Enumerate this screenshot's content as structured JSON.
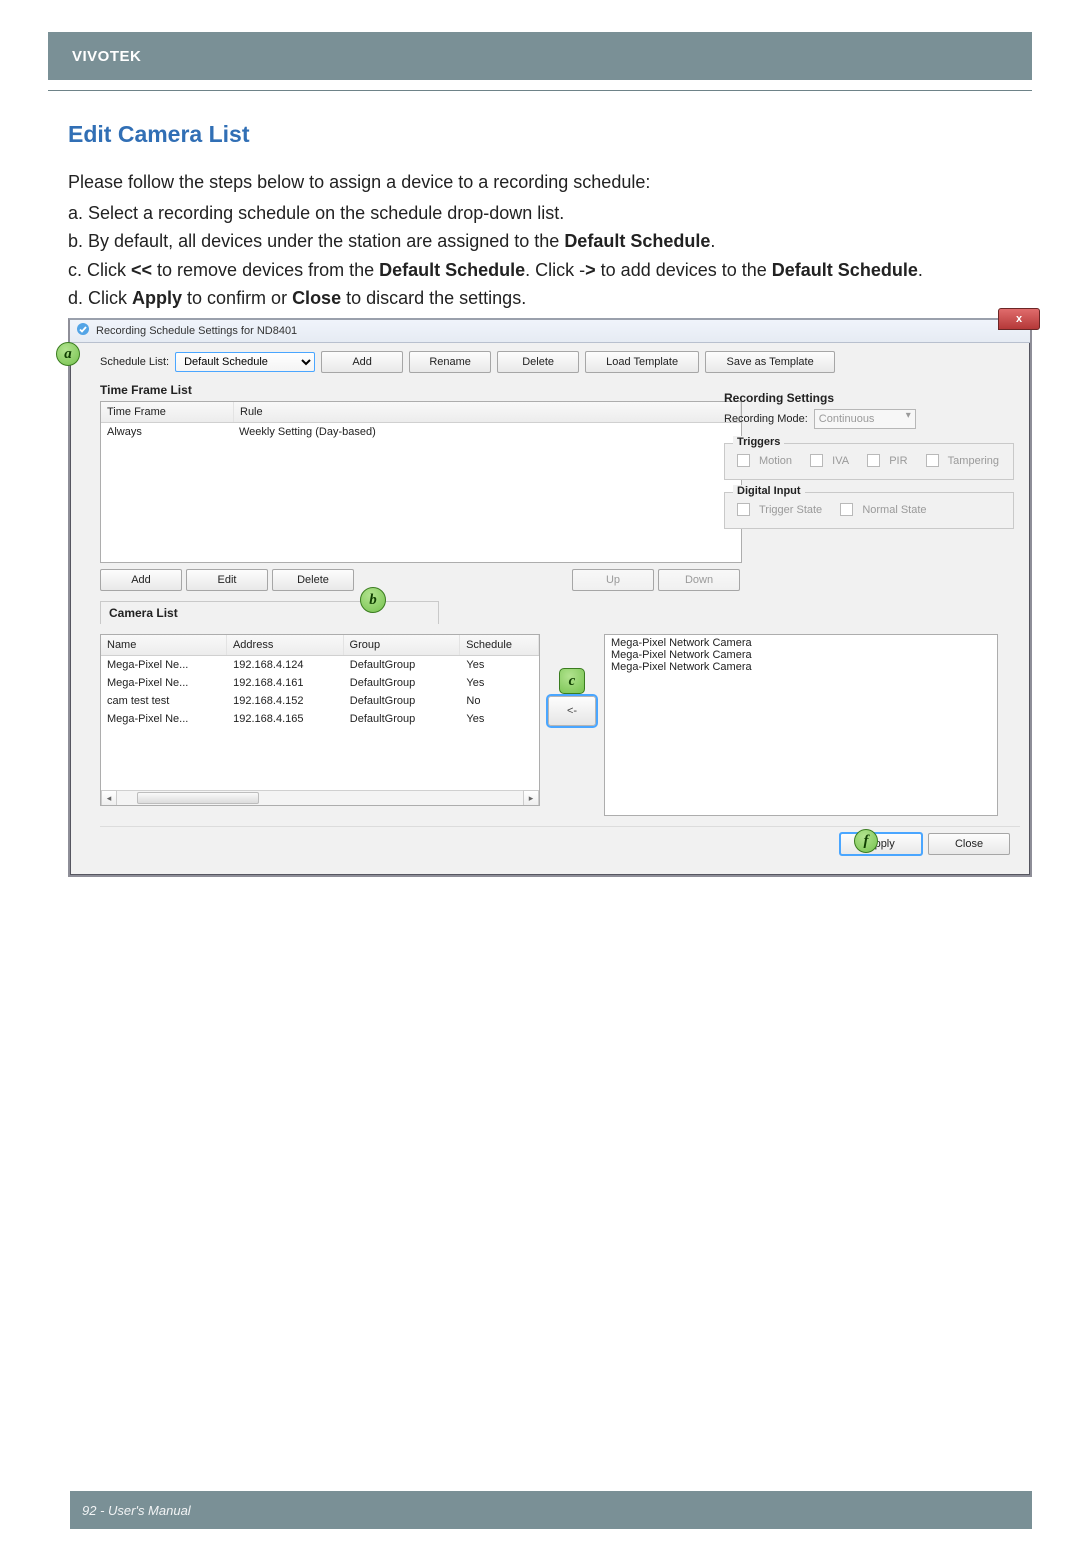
{
  "brand": "VIVOTEK",
  "section_title": "Edit Camera List",
  "intro": "Please follow the steps below to assign a device to a recording schedule:",
  "steps": {
    "a": "a. Select a recording schedule on the schedule drop-down list.",
    "b_prefix": "b. By default, all devices under the station are assigned to the ",
    "b_bold": "Default Schedule",
    "b_suffix": ".",
    "c_p1": "c. Click ",
    "c_b1": "<<",
    "c_p2": " to remove devices from the ",
    "c_b2": "Default Schedule",
    "c_p3": ". Click -",
    "c_b3": ">",
    "c_p4": " to add devices to the ",
    "c_b4": "Default Schedule",
    "c_p5": ".",
    "d_p1": "d. Click ",
    "d_b1": "Apply",
    "d_p2": " to confirm or ",
    "d_b2": "Close",
    "d_p3": " to discard the settings."
  },
  "dialog": {
    "title": "Recording Schedule Settings for ND8401",
    "close": "x",
    "schedule_list_label": "Schedule List:",
    "schedule_selected": "Default Schedule",
    "buttons": {
      "add": "Add",
      "rename": "Rename",
      "delete": "Delete",
      "load_template": "Load Template",
      "save_template": "Save as Template"
    },
    "time_frame_title": "Time Frame List",
    "time_frame_headers": {
      "col1": "Time Frame",
      "col2": "Rule"
    },
    "time_frame_rows": [
      {
        "name": "Always",
        "rule": "Weekly Setting (Day-based)"
      }
    ],
    "tf_actions": {
      "add": "Add",
      "edit": "Edit",
      "delete": "Delete",
      "up": "Up",
      "down": "Down"
    },
    "recording_settings_title": "Recording Settings",
    "recording_mode_label": "Recording Mode:",
    "recording_mode_value": "Continuous",
    "triggers_title": "Triggers",
    "triggers": {
      "motion": "Motion",
      "iva": "IVA",
      "pir": "PIR",
      "tampering": "Tampering"
    },
    "digital_input_title": "Digital Input",
    "digital_input": {
      "trigger_state": "Trigger State",
      "normal_state": "Normal State"
    },
    "camera_list_title": "Camera List",
    "camera_headers": {
      "name": "Name",
      "address": "Address",
      "group": "Group",
      "schedule": "Schedule"
    },
    "camera_rows": [
      {
        "name": "Mega-Pixel Ne...",
        "address": "192.168.4.124",
        "group": "DefaultGroup",
        "schedule": "Yes"
      },
      {
        "name": "Mega-Pixel Ne...",
        "address": "192.168.4.161",
        "group": "DefaultGroup",
        "schedule": "Yes"
      },
      {
        "name": "cam test test",
        "address": "192.168.4.152",
        "group": "DefaultGroup",
        "schedule": "No"
      },
      {
        "name": "Mega-Pixel Ne...",
        "address": "192.168.4.165",
        "group": "DefaultGroup",
        "schedule": "Yes"
      }
    ],
    "target_items": [
      "Mega-Pixel Network Camera",
      "Mega-Pixel Network Camera",
      "Mega-Pixel Network Camera"
    ],
    "move_add": "->",
    "move_remove": "<-",
    "apply": "Apply",
    "close_btn": "Close"
  },
  "annotations": {
    "a": "a",
    "b": "b",
    "c": "c",
    "f": "f"
  },
  "page_footer": "92 - User's Manual"
}
